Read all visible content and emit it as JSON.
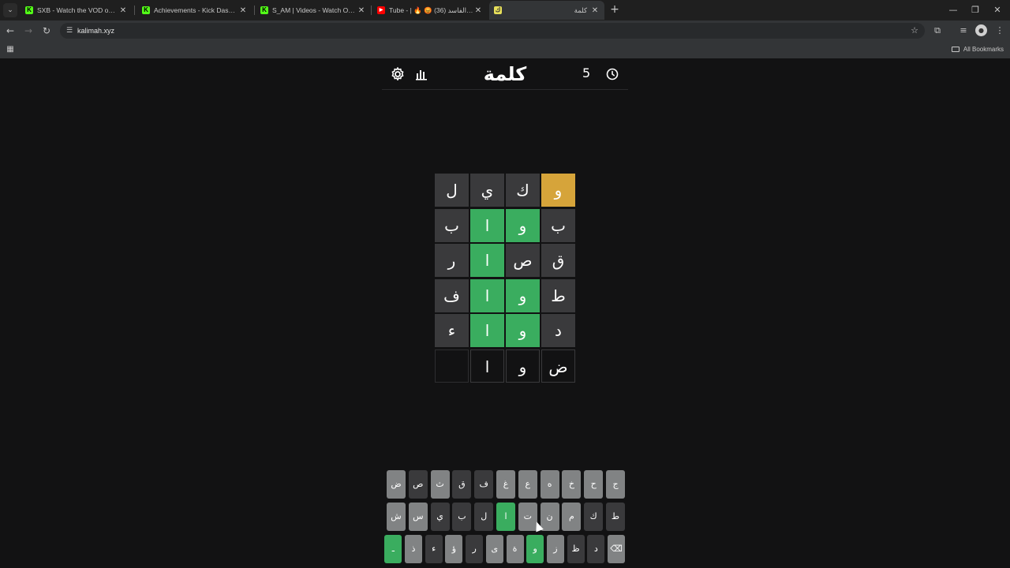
{
  "browser": {
    "tabs": [
      {
        "title": "SXB - Watch the VOD on Kick",
        "favicon": "kick-icon"
      },
      {
        "title": "Achievements - Kick Dashboard",
        "favicon": "kick-icon"
      },
      {
        "title": "S_AM | Videos - Watch On-Dem",
        "favicon": "kick-icon"
      },
      {
        "title": "Tube - | 🔥 😡 (36) كشف الفاسد",
        "favicon": "youtube-icon"
      },
      {
        "title": "كلمة",
        "favicon": "kalimah-icon",
        "active": true
      }
    ],
    "url": "kalimah.xyz",
    "bookmarks_label": "All Bookmarks"
  },
  "game": {
    "title": "كلمة",
    "streak": "5",
    "board": [
      [
        {
          "letter": "و",
          "state": "present"
        },
        {
          "letter": "ك",
          "state": "absent"
        },
        {
          "letter": "ي",
          "state": "absent"
        },
        {
          "letter": "ل",
          "state": "absent"
        }
      ],
      [
        {
          "letter": "ب",
          "state": "absent"
        },
        {
          "letter": "و",
          "state": "correct"
        },
        {
          "letter": "ا",
          "state": "correct"
        },
        {
          "letter": "ب",
          "state": "absent"
        }
      ],
      [
        {
          "letter": "ق",
          "state": "absent"
        },
        {
          "letter": "ص",
          "state": "absent"
        },
        {
          "letter": "ا",
          "state": "correct"
        },
        {
          "letter": "ر",
          "state": "absent"
        }
      ],
      [
        {
          "letter": "ط",
          "state": "absent"
        },
        {
          "letter": "و",
          "state": "correct"
        },
        {
          "letter": "ا",
          "state": "correct"
        },
        {
          "letter": "ف",
          "state": "absent"
        }
      ],
      [
        {
          "letter": "د",
          "state": "absent"
        },
        {
          "letter": "و",
          "state": "correct"
        },
        {
          "letter": "ا",
          "state": "correct"
        },
        {
          "letter": "ء",
          "state": "absent"
        }
      ],
      [
        {
          "letter": "ض",
          "state": "tbd"
        },
        {
          "letter": "و",
          "state": "tbd"
        },
        {
          "letter": "ا",
          "state": "tbd"
        },
        {
          "letter": "",
          "state": "empty"
        }
      ]
    ],
    "keyboard": [
      [
        "ج",
        "ح",
        "خ",
        "ه",
        "ع",
        "غ",
        "ف",
        "ق",
        "ث",
        "ص",
        "ض"
      ],
      [
        "ط",
        "ك",
        "م",
        "ن",
        "ت",
        "ا",
        "ل",
        "ب",
        "ي",
        "س",
        "ش"
      ],
      [
        "⌫",
        "د",
        "ظ",
        "ز",
        "و",
        "ة",
        "ى",
        "ر",
        "ؤ",
        "ء",
        "ذ",
        "ـ"
      ]
    ],
    "keyboard_states": [
      [
        "unused",
        "unused",
        "unused",
        "unused",
        "unused",
        "unused",
        "absent",
        "absent",
        "unused",
        "absent",
        "unused"
      ],
      [
        "absent",
        "absent",
        "unused",
        "unused",
        "unused",
        "correct",
        "absent",
        "absent",
        "absent",
        "unused",
        "unused"
      ],
      [
        "unused",
        "absent",
        "absent",
        "unused",
        "correct",
        "unused",
        "unused",
        "absent",
        "unused",
        "absent",
        "unused",
        "correct"
      ]
    ],
    "colors": {
      "correct": "#3aad5f",
      "present": "#d6a43a",
      "absent": "#3a3a3c",
      "unused": "#818384",
      "background": "#121213"
    }
  }
}
